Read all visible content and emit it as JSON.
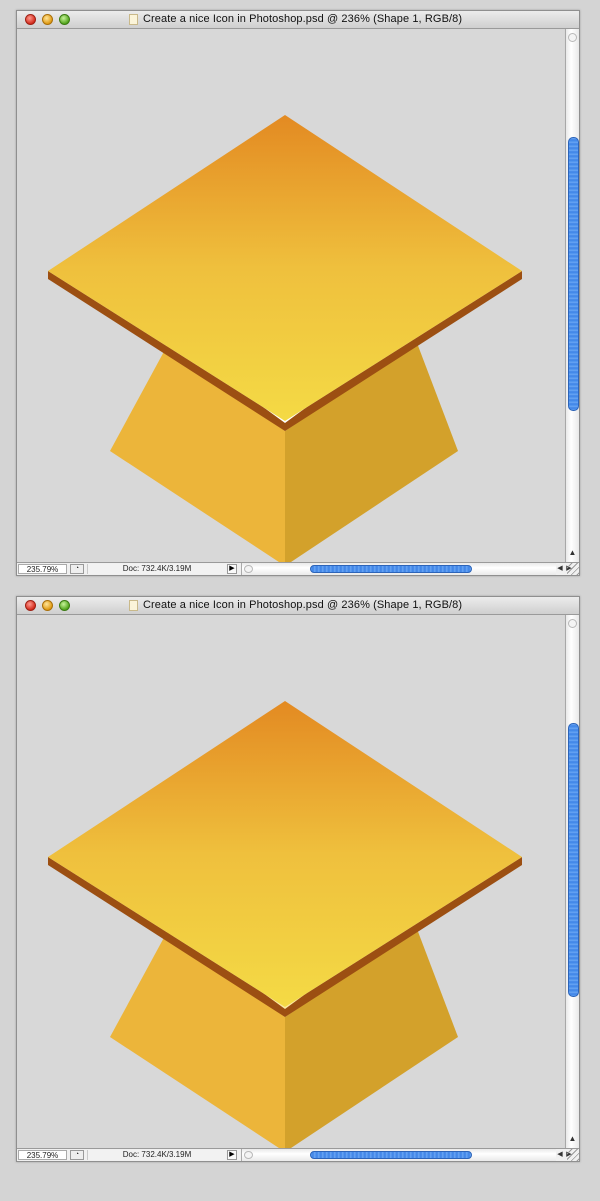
{
  "windows": [
    {
      "title": "Create a nice Icon in Photoshop.psd @ 236% (Shape 1, RGB/8)",
      "zoom": "235.79%",
      "doc_info": "Doc: 732.4K/3.19M",
      "status_menu_icon": "▶",
      "variant": "white-highlight"
    },
    {
      "title": "Create a nice Icon in Photoshop.psd @ 236% (Shape 1, RGB/8)",
      "zoom": "235.79%",
      "doc_info": "Doc: 732.4K/3.19M",
      "status_menu_icon": "▶",
      "variant": "cream-highlight"
    }
  ],
  "controls": {
    "scroll_up": "▲",
    "scroll_down": "▼",
    "scroll_left": "◀",
    "scroll_right": "▶"
  },
  "colors": {
    "top_dark": "#e38a22",
    "top_light": "#f4da45",
    "base_left": "#ecb53a",
    "base_right": "#d3a12b",
    "edge": "#9c4f12",
    "highlight_1": "#ffffff",
    "highlight_2": "#fbe9a4",
    "scroll_blue": "#3d82e6"
  }
}
